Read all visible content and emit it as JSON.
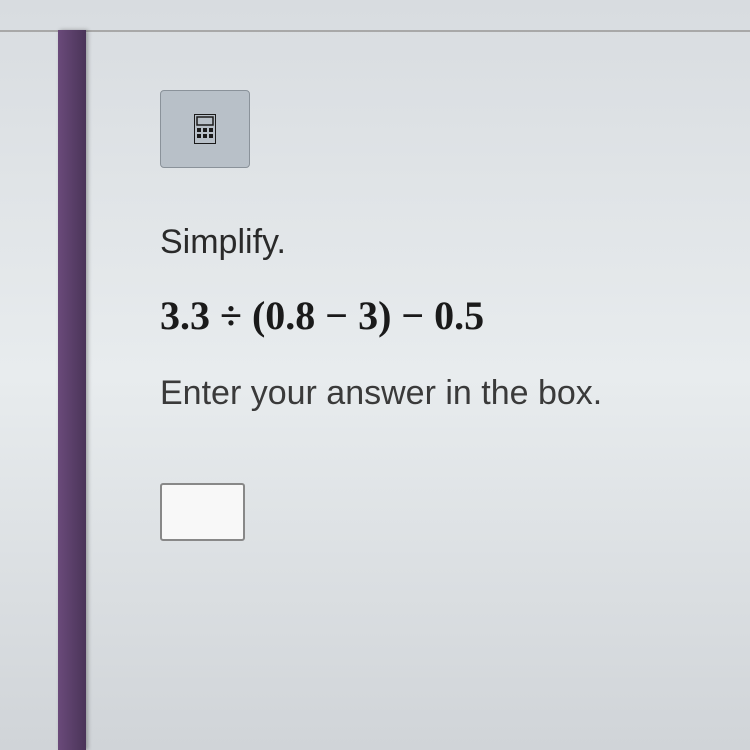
{
  "question": {
    "instruction": "Simplify.",
    "expression": "3.3 ÷ (0.8 − 3) − 0.5",
    "prompt": "Enter your answer in the box.",
    "answer_value": ""
  },
  "toolbar": {
    "calculator_label": "calculator"
  }
}
